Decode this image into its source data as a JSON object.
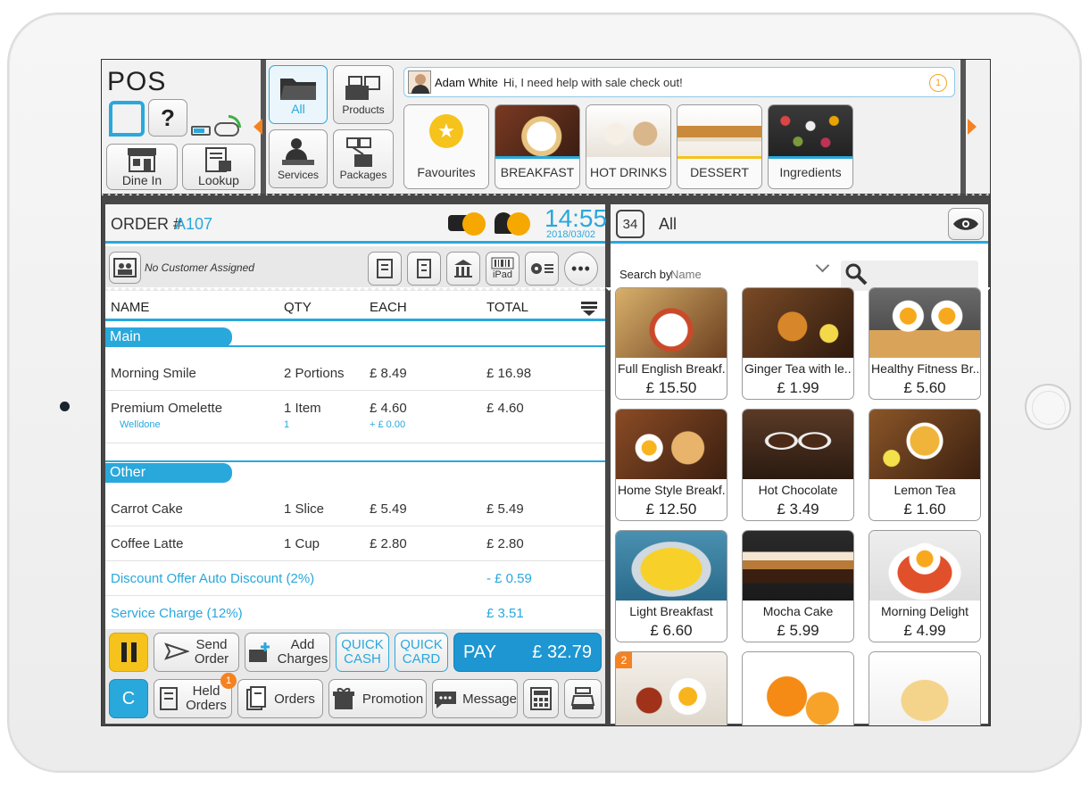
{
  "brand": {
    "name": "POS",
    "help": "?"
  },
  "left_buttons": [
    {
      "label": "Dine In"
    },
    {
      "label": "Lookup"
    }
  ],
  "menu_buttons": [
    {
      "label": "All"
    },
    {
      "label": "Products"
    },
    {
      "label": "Services"
    },
    {
      "label": "Packages"
    }
  ],
  "message": {
    "user": "Adam White",
    "text": "Hi, I need help with sale check out!",
    "count": "1"
  },
  "categories": [
    {
      "label": "Favourites"
    },
    {
      "label": "BREAKFAST"
    },
    {
      "label": "HOT DRINKS"
    },
    {
      "label": "DESSERT"
    },
    {
      "label": "Ingredients"
    }
  ],
  "order": {
    "title": "ORDER #",
    "number": "A107",
    "time": "14:55",
    "date": "2018/03/02",
    "customer": "No Customer Assigned",
    "ipad_label": "iPad",
    "columns": {
      "name": "NAME",
      "qty": "QTY",
      "each": "EACH",
      "total": "TOTAL"
    },
    "sections": [
      {
        "title": "Main"
      },
      {
        "title": "Other"
      }
    ],
    "main_items": [
      {
        "name": "Morning Smile",
        "qty": "2 Portions",
        "each": "£ 8.49",
        "total": "£ 16.98"
      },
      {
        "name": "Premium Omelette",
        "qty": "1 Item",
        "each": "£ 4.60",
        "total": "£ 4.60",
        "modifier": "Welldone",
        "modifier_qty": "1",
        "modifier_price": "+ £ 0.00"
      }
    ],
    "other_items": [
      {
        "name": "Carrot Cake",
        "qty": "1 Slice",
        "each": "£ 5.49",
        "total": "£ 5.49"
      },
      {
        "name": "Coffee Latte",
        "qty": "1 Cup",
        "each": "£ 2.80",
        "total": "£ 2.80"
      }
    ],
    "adjustments": [
      {
        "name": "Discount Offer Auto Discount (2%)",
        "total": "- £ 0.59"
      },
      {
        "name": "Service Charge (12%)",
        "total": "£ 3.51"
      }
    ]
  },
  "actions": {
    "send_order": [
      "Send",
      "Order"
    ],
    "add_charges": [
      "Add",
      "Charges"
    ],
    "quick_cash": [
      "QUICK",
      "CASH"
    ],
    "quick_card": [
      "QUICK",
      "CARD"
    ],
    "pay_label": "PAY",
    "pay_amount": "£ 32.79",
    "clear": "C",
    "held_orders": [
      "Held",
      "Orders"
    ],
    "held_badge": "1",
    "orders": "Orders",
    "promotion": "Promotion",
    "message": "Message"
  },
  "products_panel": {
    "count": "34",
    "filter": "All",
    "search_by": "Search by",
    "search_field": "Name",
    "items": [
      {
        "name": "Full English Breakf...",
        "price": "£ 15.50"
      },
      {
        "name": "Ginger Tea with le...",
        "price": "£ 1.99"
      },
      {
        "name": "Healthy Fitness Br...",
        "price": "£ 5.60"
      },
      {
        "name": "Home Style Breakf...",
        "price": "£ 12.50"
      },
      {
        "name": "Hot Chocolate",
        "price": "£ 3.49"
      },
      {
        "name": "Lemon Tea",
        "price": "£ 1.60"
      },
      {
        "name": "Light Breakfast",
        "price": "£ 6.60"
      },
      {
        "name": "Mocha Cake",
        "price": "£ 5.99"
      },
      {
        "name": "Morning Delight",
        "price": "£ 4.99"
      }
    ],
    "partial_badge": "2"
  },
  "colors": {
    "accent": "#29a8dc",
    "pay": "#1d96d1",
    "pause": "#f6c21c",
    "orange": "#f58220"
  }
}
